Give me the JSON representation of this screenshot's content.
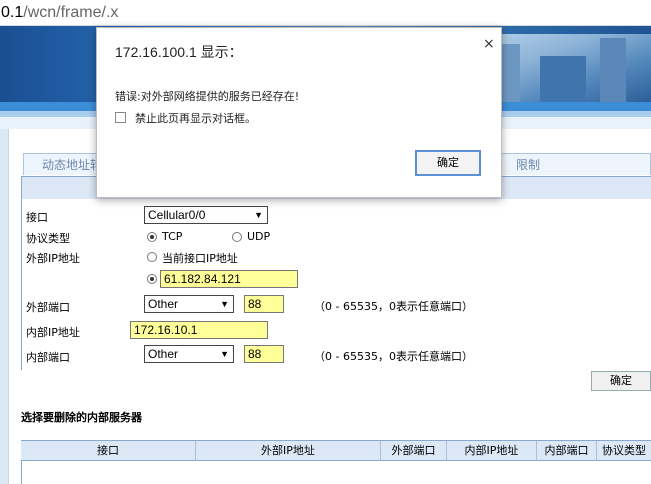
{
  "browser": {
    "url_prefix": "0.1",
    "url_path": "/wcn/frame/.x"
  },
  "tabs": {
    "tab1": "动态地址转",
    "tab2": "限制"
  },
  "form": {
    "interface_label": "接口",
    "interface_value": "Cellular0/0",
    "protocol_label": "协议类型",
    "protocol_tcp": "TCP",
    "protocol_udp": "UDP",
    "protocol_selected": "TCP",
    "ext_ip_label": "外部IP地址",
    "ext_ip_option_current": "当前接口IP地址",
    "ext_ip_value": "61.182.84.121",
    "ext_port_label": "外部端口",
    "ext_port_select": "Other",
    "ext_port_value": "88",
    "port_hint": "（0 - 65535，0表示任意端口）",
    "int_ip_label": "内部IP地址",
    "int_ip_value": "172.16.10.1",
    "int_port_label": "内部端口",
    "int_port_select": "Other",
    "int_port_value": "88",
    "confirm": "确定"
  },
  "delete_section": {
    "title": "选择要删除的内部服务器",
    "columns": [
      "接口",
      "外部IP地址",
      "外部端口",
      "内部IP地址",
      "内部端口",
      "协议类型"
    ]
  },
  "dialog": {
    "title": "172.16.100.1 显示：",
    "close": "×",
    "message": "错误:对外部网络提供的服务已经存在!",
    "checkbox_label": "禁止此页再显示对话框。",
    "ok": "确定"
  },
  "colors": {
    "input_highlight": "#ffff99",
    "header_bg": "#dde8f6",
    "dialog_button_border": "#5b8fd6"
  }
}
